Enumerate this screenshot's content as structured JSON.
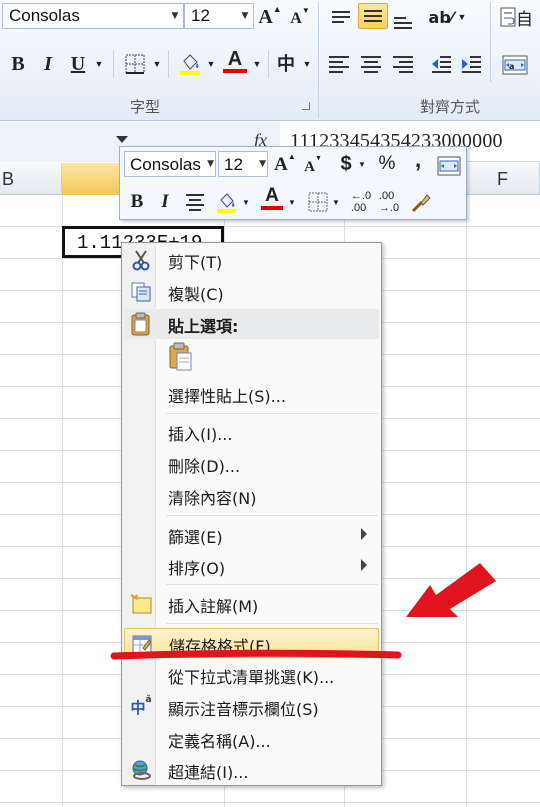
{
  "ribbon": {
    "font_name": "Consolas",
    "font_size": "12",
    "grow_font": "A",
    "shrink_font": "A",
    "bold": "B",
    "italic": "I",
    "underline": "U",
    "font_color_letter": "A",
    "phonetic_glyph": "中",
    "group_font_label": "字型",
    "group_alignment_label": "對齊方式",
    "wrap_text_partial": "自"
  },
  "formula_bar": {
    "fx": "fx",
    "value": "111233454354233000000"
  },
  "columns": {
    "b": "B",
    "f": "F"
  },
  "active_cell": {
    "value": "1.11233E+19"
  },
  "mini_toolbar": {
    "font_name": "Consolas",
    "font_size": "12",
    "grow_font": "A",
    "shrink_font": "A",
    "currency": "$",
    "percent": "%",
    "comma": ",",
    "bold": "B",
    "italic": "I",
    "font_color_letter": "A"
  },
  "context_menu": {
    "items": [
      {
        "label": "剪下(T)",
        "icon": "scissors-icon"
      },
      {
        "label": "複製(C)",
        "icon": "copy-icon"
      },
      {
        "label": "貼上選項:",
        "icon": "paste-icon"
      },
      {
        "label": "選擇性貼上(S)..."
      },
      {
        "label": "插入(I)..."
      },
      {
        "label": "刪除(D)..."
      },
      {
        "label": "清除內容(N)"
      },
      {
        "label": "篩選(E)",
        "submenu": true
      },
      {
        "label": "排序(O)",
        "submenu": true
      },
      {
        "label": "插入註解(M)",
        "icon": "comment-icon"
      },
      {
        "label": "儲存格格式(F)...",
        "icon": "format-cells-icon",
        "highlighted": true
      },
      {
        "label": "從下拉式清單挑選(K)..."
      },
      {
        "label": "顯示注音標示欄位(S)",
        "icon": "phonetic-icon"
      },
      {
        "label": "定義名稱(A)..."
      },
      {
        "label": "超連結(I)...",
        "icon": "hyperlink-icon"
      }
    ]
  },
  "colors": {
    "accent_highlight": "#fde59b",
    "annotation_red": "#e0141e",
    "font_color_bar": "#e00000"
  }
}
